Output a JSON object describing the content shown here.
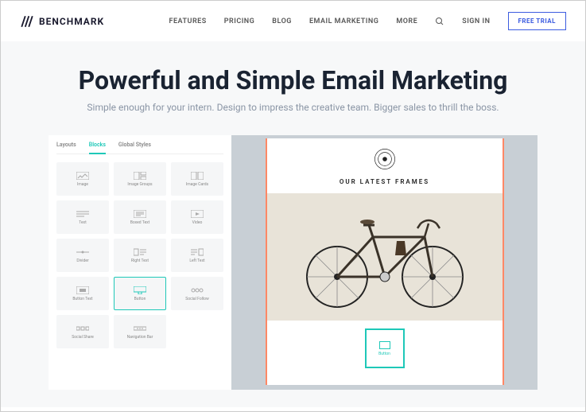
{
  "brand": "BENCHMARK",
  "nav": {
    "features": "FEATURES",
    "pricing": "PRICING",
    "blog": "BLOG",
    "email": "EMAIL MARKETING",
    "more": "MORE",
    "signin": "SIGN IN",
    "trial": "FREE TRIAL"
  },
  "hero": {
    "title": "Powerful and Simple Email Marketing",
    "subtitle": "Simple enough for your intern. Design to impress the creative team. Bigger sales to thrill the boss."
  },
  "editor": {
    "tabs": {
      "layouts": "Layouts",
      "blocks": "Blocks",
      "global": "Global Styles"
    },
    "blocks": [
      "Image",
      "Image Groups",
      "Image Cards",
      "Text",
      "Boxed Text",
      "Video",
      "Divider",
      "Right Text",
      "Left Text",
      "Button Text",
      "Button",
      "Social Follow",
      "Social Share",
      "Navigation Bar"
    ],
    "canvas": {
      "title": "OUR LATEST FRAMES",
      "drop": "Button"
    }
  }
}
